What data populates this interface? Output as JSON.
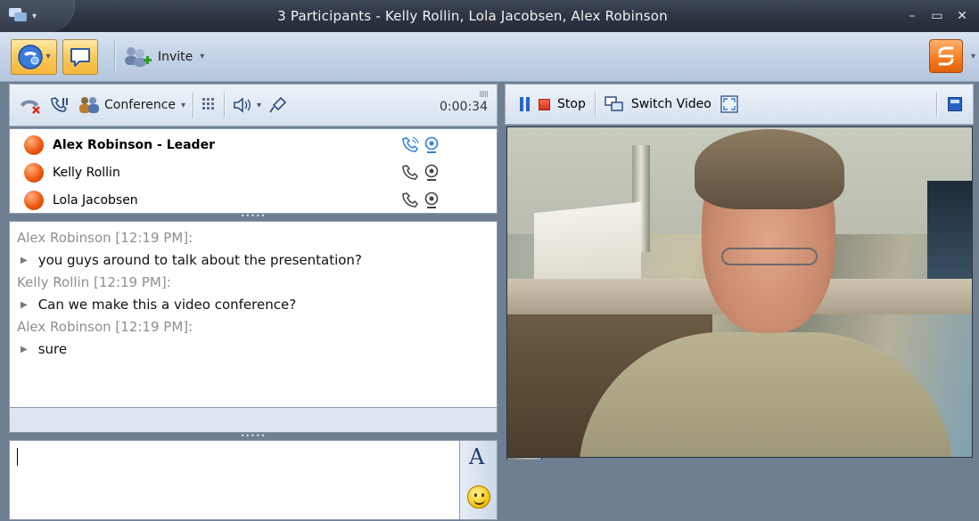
{
  "window": {
    "title": "3 Participants - Kelly Rollin, Lola Jacobsen, Alex Robinson",
    "controls": {
      "minimize": "–",
      "maximize": "▭",
      "close": "✕"
    }
  },
  "toolbar": {
    "invite_label": "Invite",
    "icons": [
      "call-icon",
      "webcam-icon",
      "chat-bubble-icon",
      "invite-people-icon",
      "brand-logo-icon"
    ]
  },
  "call_toolbar": {
    "conference_label": "Conference",
    "timer": "0:00:34",
    "signal_bars": "IIIII",
    "icons": [
      "hangup-icon",
      "hold-call-icon",
      "conference-icon",
      "dialpad-icon",
      "speaker-icon",
      "microphone-icon"
    ]
  },
  "participants": [
    {
      "name": "Alex Robinson - Leader",
      "leader": true,
      "status_color": "#ef5a12"
    },
    {
      "name": "Kelly Rollin",
      "leader": false,
      "status_color": "#ef5a12"
    },
    {
      "name": "Lola Jacobsen",
      "leader": false,
      "status_color": "#ef5a12"
    }
  ],
  "chat": {
    "messages": [
      {
        "sender": "Alex Robinson [12:19 PM]:",
        "text": "you guys around to talk about the presentation?"
      },
      {
        "sender": "Kelly Rollin [12:19 PM]:",
        "text": "Can we make this a video conference?"
      },
      {
        "sender": "Alex Robinson [12:19 PM]:",
        "text": "sure"
      }
    ],
    "input_value": ""
  },
  "video_toolbar": {
    "stop_label": "Stop",
    "switch_label": "Switch Video"
  },
  "colors": {
    "accent_orange": "#f47a1f",
    "toolbar_blue": "#c3d2e6",
    "frame_dark": "#2d3441"
  }
}
